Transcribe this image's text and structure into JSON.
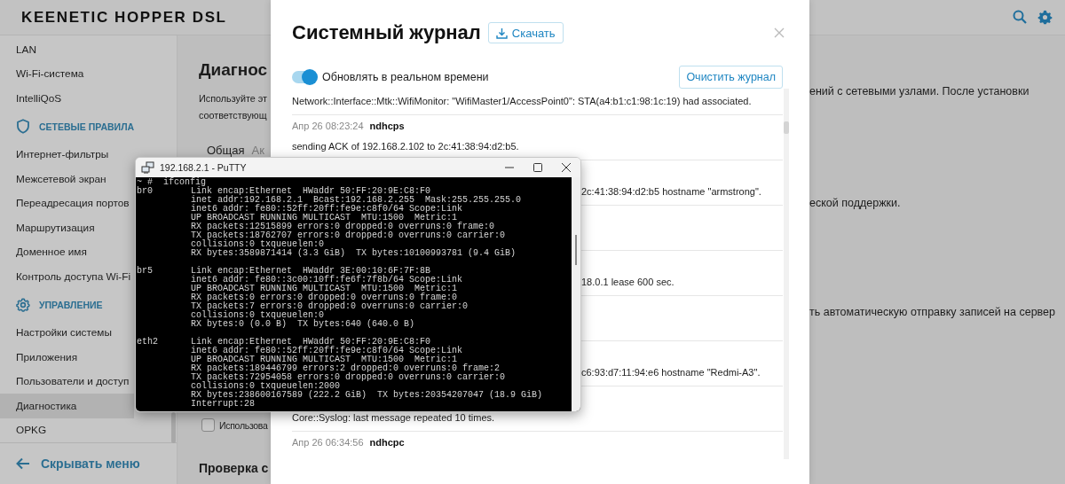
{
  "header": {
    "logo": "KEENETIC HOPPER DSL"
  },
  "sidebar": {
    "sections": [
      {
        "items": [
          {
            "label": "LAN",
            "selected": false
          },
          {
            "label": "Wi-Fi-система",
            "selected": false
          },
          {
            "label": "IntelliQoS",
            "selected": false
          }
        ]
      },
      {
        "title": "СЕТЕВЫЕ ПРАВИЛА",
        "items": [
          {
            "label": "Интернет-фильтры",
            "selected": false
          },
          {
            "label": "Межсетевой экран",
            "selected": false
          },
          {
            "label": "Переадресация портов",
            "selected": false
          },
          {
            "label": "Маршрутизация",
            "selected": false
          },
          {
            "label": "Доменное имя",
            "selected": false
          },
          {
            "label": "Контроль доступа Wi-Fi",
            "selected": false
          }
        ]
      },
      {
        "title": "УПРАВЛЕНИЕ",
        "items": [
          {
            "label": "Настройки системы",
            "selected": false
          },
          {
            "label": "Приложения",
            "selected": false
          },
          {
            "label": "Пользователи и доступ",
            "selected": false
          },
          {
            "label": "Диагностика",
            "selected": true
          },
          {
            "label": "OPKG",
            "selected": false
          }
        ]
      }
    ],
    "collapse": "Скрывать меню"
  },
  "page": {
    "title": "Диагнос",
    "description": [
      "Используйте эт",
      "соответствующ"
    ],
    "tabs": [
      {
        "label": "Общая",
        "selected": true
      },
      {
        "label": "Ак",
        "selected": false
      }
    ],
    "checkbox": {
      "label": "Использова",
      "checked": false
    },
    "section_title": "Проверка с",
    "right_texts": [
      "ений с сетевыми узлами. После установки",
      "еской поддержки.",
      "ть автоматическую отправку записей на сервер"
    ]
  },
  "modal": {
    "title": "Системный журнал",
    "download": "Скачать",
    "realtime": {
      "label": "Обновлять в реальном времени",
      "on": true
    },
    "clear": "Очистить журнал",
    "entries": [
      {
        "kind": "message",
        "message": "Network::Interface::Mtk::WifiMonitor: \"WifiMaster1/AccessPoint0\": STA(a4:b1:c1:98:1c:19) had associated."
      },
      {
        "kind": "full",
        "time": "Апр 26 08:23:24",
        "source": "ndhcps",
        "message": "sending ACK of 192.168.2.102 to 2c:41:38:94:d2:b5."
      },
      {
        "kind": "covered",
        "message": "2c:41:38:94:d2:b5 hostname \"armstrong\"."
      },
      {
        "kind": "hidden"
      },
      {
        "kind": "covered",
        "message": "18.0.1 lease 600 sec."
      },
      {
        "kind": "hidden"
      },
      {
        "kind": "covered",
        "message": "c6:93:d7:11:94:e6 hostname \"Redmi-A3\"."
      },
      {
        "kind": "message",
        "message": "Core::Syslog: last message repeated 10 times."
      },
      {
        "kind": "full",
        "time": "Апр 26 06:34:56",
        "source": "ndhcpc"
      }
    ]
  },
  "putty": {
    "title": "192.168.2.1 - PuTTY",
    "prompt": "~ #  ifconfig",
    "interfaces": [
      {
        "name": "br0",
        "lines": [
          "Link encap:Ethernet  HWaddr 50:FF:20:9E:C8:F0",
          "inet addr:192.168.2.1  Bcast:192.168.2.255  Mask:255.255.255.0",
          "inet6 addr: fe80::52ff:20ff:fe9e:c8f0/64 Scope:Link",
          "UP BROADCAST RUNNING MULTICAST  MTU:1500  Metric:1",
          "RX packets:12515899 errors:0 dropped:0 overruns:0 frame:0",
          "TX packets:18762707 errors:0 dropped:0 overruns:0 carrier:0",
          "collisions:0 txqueuelen:0",
          "RX bytes:3589871414 (3.3 GiB)  TX bytes:10100993781 (9.4 GiB)"
        ]
      },
      {
        "name": "br5",
        "lines": [
          "Link encap:Ethernet  HWaddr 3E:00:10:6F:7F:8B",
          "inet6 addr: fe80::3c00:10ff:fe6f:7f8b/64 Scope:Link",
          "UP BROADCAST RUNNING MULTICAST  MTU:1500  Metric:1",
          "RX packets:0 errors:0 dropped:0 overruns:0 frame:0",
          "TX packets:7 errors:0 dropped:0 overruns:0 carrier:0",
          "collisions:0 txqueuelen:0",
          "RX bytes:0 (0.0 B)  TX bytes:640 (640.0 B)"
        ]
      },
      {
        "name": "eth2",
        "lines": [
          "Link encap:Ethernet  HWaddr 50:FF:20:9E:C8:F0",
          "inet6 addr: fe80::52ff:20ff:fe9e:c8f0/64 Scope:Link",
          "UP BROADCAST RUNNING MULTICAST  MTU:1500  Metric:1",
          "RX packets:189446799 errors:2 dropped:0 overruns:0 frame:2",
          "TX packets:72954058 errors:0 dropped:0 overruns:0 carrier:0",
          "collisions:0 txqueuelen:2000",
          "RX bytes:238600167589 (222.2 GiB)  TX bytes:20354207047 (18.9 GiB)",
          "Interrupt:28"
        ]
      }
    ]
  }
}
